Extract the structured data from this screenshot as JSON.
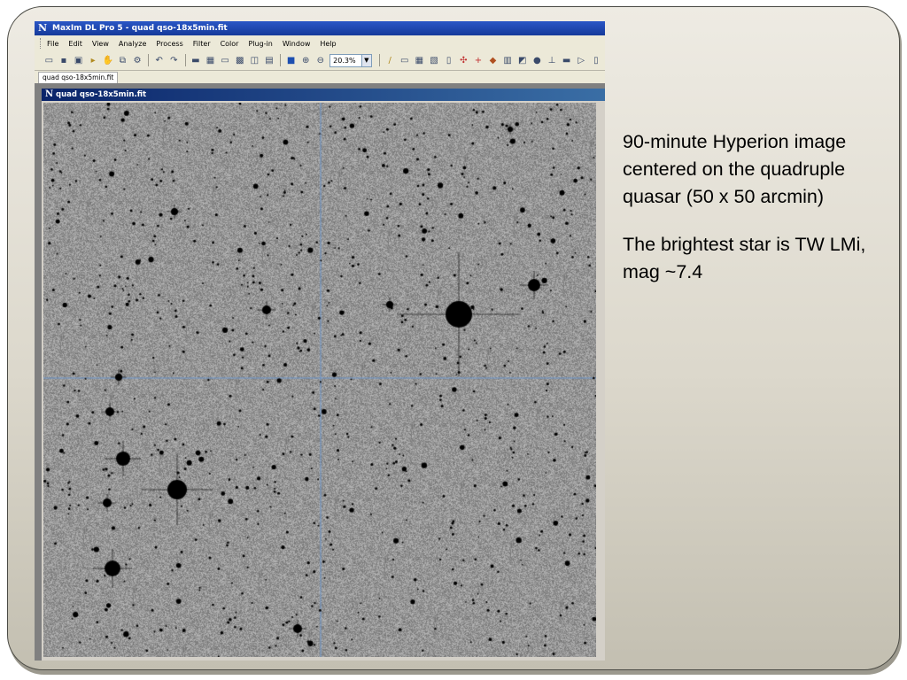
{
  "app": {
    "title": "MaxIm DL Pro 5 - quad qso-18x5min.fit",
    "logo_glyph": "N",
    "menu": [
      "File",
      "Edit",
      "View",
      "Analyze",
      "Process",
      "Filter",
      "Color",
      "Plug-in",
      "Window",
      "Help"
    ],
    "toolbar": {
      "zoom_value": "20.3%",
      "icons_left": [
        "open-icon",
        "save-icon",
        "save-all-icon",
        "run-icon",
        "hand-icon",
        "copy-icon",
        "settings-icon"
      ],
      "icons_mid": [
        "undo-icon",
        "redo-icon",
        "image-icon",
        "screen-icon",
        "window-icon",
        "stack-icon",
        "camera-icon",
        "tile-icon",
        "fit-icon",
        "zoom-in-icon",
        "zoom-out-icon"
      ],
      "icons_right": [
        "pencil-icon",
        "graph-icon",
        "tools-icon",
        "layers-icon",
        "pages-icon",
        "star-icon",
        "crosshair-icon",
        "magic-icon",
        "film-icon",
        "edit-icon",
        "blob-icon",
        "scale-icon",
        "line-icon",
        "export-icon",
        "more-icon"
      ]
    },
    "doc_tab": "quad qso-18x5min.fit",
    "image_window_title": "quad qso-18x5min.fit"
  },
  "caption": {
    "paragraph1": "90-minute Hyperion image centered on the quadruple quasar (50 x 50 arcmin)",
    "paragraph2": "The brightest star is TW LMi, mag ~7.4"
  }
}
